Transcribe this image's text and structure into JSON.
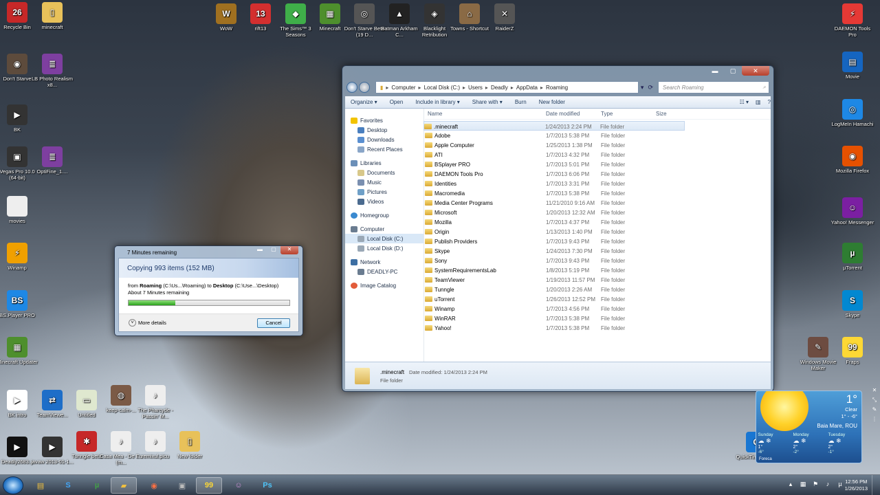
{
  "desktop_icons": [
    {
      "label": "Recycle Bin",
      "icon": "recycle-bin-icon",
      "color": "#c62828",
      "glyph": "26"
    },
    {
      "label": "minecraft",
      "icon": "folder-icon",
      "color": "#e8c15a",
      "glyph": "▯"
    },
    {
      "label": "Don't Starve",
      "icon": "game-icon",
      "color": "#5d4b3c",
      "glyph": "◉"
    },
    {
      "label": "LB Photo Realism x8...",
      "icon": "archive-icon",
      "color": "#7e3fa0",
      "glyph": "≣"
    },
    {
      "label": "BK",
      "icon": "video-icon",
      "color": "#333",
      "glyph": "▶"
    },
    {
      "label": "Vegas Pro 10.0 (64-bit)",
      "icon": "vegas-icon",
      "color": "#333",
      "glyph": "▣"
    },
    {
      "label": "OptiFine_1....",
      "icon": "archive-icon",
      "color": "#7e3fa0",
      "glyph": "≣"
    },
    {
      "label": "movies",
      "icon": "file-icon",
      "color": "#eeeeee",
      "glyph": ""
    },
    {
      "label": "Winamp",
      "icon": "winamp-icon",
      "color": "#f0a000",
      "glyph": "⚡"
    },
    {
      "label": "BS.Player PRO",
      "icon": "bsplayer-icon",
      "color": "#1e88e5",
      "glyph": "BS"
    },
    {
      "label": "Minecraft Updater",
      "icon": "minecraft-icon",
      "color": "#4e8f2d",
      "glyph": "▦"
    },
    {
      "label": "BK intro",
      "icon": "video-icon",
      "color": "#ffffff",
      "glyph": "▶"
    },
    {
      "label": "TeamViewe...",
      "icon": "teamviewer-icon",
      "color": "#1e6ec8",
      "glyph": "⇄"
    },
    {
      "label": "Untitled",
      "icon": "image-icon",
      "color": "#dfe8cf",
      "glyph": "▭"
    },
    {
      "label": "keep-calm-...",
      "icon": "image-icon",
      "color": "#7b5a46",
      "glyph": "◍"
    },
    {
      "label": "The Pharcyde - Passin' M...",
      "icon": "audio-icon",
      "color": "#eeeeee",
      "glyph": "♪"
    },
    {
      "label": "Deadly2683...",
      "icon": "video-icon",
      "color": "#111",
      "glyph": "▶"
    },
    {
      "label": "javaw 2013-01-1...",
      "icon": "video-icon",
      "color": "#333",
      "glyph": "▶"
    },
    {
      "label": "Tunngle beta",
      "icon": "tunngle-icon",
      "color": "#c62828",
      "glyph": "✱"
    },
    {
      "label": "Casa Mea - De Eu (m...",
      "icon": "audio-icon",
      "color": "#eeeeee",
      "glyph": "♪"
    },
    {
      "label": "remixul.picu",
      "icon": "audio-icon",
      "color": "#eeeeee",
      "glyph": "♪"
    },
    {
      "label": "New folder",
      "icon": "folder-icon",
      "color": "#e8c15a",
      "glyph": "▯"
    },
    {
      "label": "WoW",
      "icon": "wow-icon",
      "color": "#a07020",
      "glyph": "W"
    },
    {
      "label": "rift13",
      "icon": "rift-icon",
      "color": "#d32f2f",
      "glyph": "13"
    },
    {
      "label": "The Sims™ 3 Seasons",
      "icon": "sims-icon",
      "color": "#3fae49",
      "glyph": "◆"
    },
    {
      "label": "Minecraft",
      "icon": "minecraft-icon",
      "color": "#4e8f2d",
      "glyph": "▦"
    },
    {
      "label": "Don't Starve Beta (19 D...",
      "icon": "game-icon",
      "color": "#555",
      "glyph": "◎"
    },
    {
      "label": "Batman Arkham C...",
      "icon": "batman-icon",
      "color": "#222",
      "glyph": "▲"
    },
    {
      "label": "Blacklight Retribution",
      "icon": "blacklight-icon",
      "color": "#333",
      "glyph": "◈"
    },
    {
      "label": "Towns - Shortcut",
      "icon": "towns-icon",
      "color": "#8a6a45",
      "glyph": "⌂"
    },
    {
      "label": "RaiderZ",
      "icon": "raiderz-icon",
      "color": "#555",
      "glyph": "✕"
    },
    {
      "label": "DAEMON Tools Pro",
      "icon": "daemon-icon",
      "color": "#e53935",
      "glyph": "⚡"
    },
    {
      "label": "Movie",
      "icon": "movie-icon",
      "color": "#1565c0",
      "glyph": "▤"
    },
    {
      "label": "LogMeIn Hamachi",
      "icon": "hamachi-icon",
      "color": "#1e88e5",
      "glyph": "◎"
    },
    {
      "label": "Mozilla Firefox",
      "icon": "firefox-icon",
      "color": "#e65100",
      "glyph": "◉"
    },
    {
      "label": "Yahoo! Messenger",
      "icon": "yahoo-icon",
      "color": "#7b1fa2",
      "glyph": "☺"
    },
    {
      "label": "µTorrent",
      "icon": "utorrent-icon",
      "color": "#2e7d32",
      "glyph": "µ"
    },
    {
      "label": "Skype",
      "icon": "skype-icon",
      "color": "#0288d1",
      "glyph": "S"
    },
    {
      "label": "Windows Movie Maker",
      "icon": "moviemaker-icon",
      "color": "#6d4c41",
      "glyph": "✎"
    },
    {
      "label": "Fraps",
      "icon": "fraps-icon",
      "color": "#fdd835",
      "glyph": "99"
    },
    {
      "label": "QuickTime Player",
      "icon": "quicktime-icon",
      "color": "#1976d2",
      "glyph": "Q"
    }
  ],
  "explorer": {
    "breadcrumb": [
      "Computer",
      "Local Disk (C:)",
      "Users",
      "Deadly",
      "AppData",
      "Roaming"
    ],
    "search_placeholder": "Search Roaming",
    "toolbar": {
      "organize": "Organize ▾",
      "open": "Open",
      "include": "Include in library ▾",
      "share": "Share with ▾",
      "burn": "Burn",
      "new_folder": "New folder"
    },
    "columns": {
      "name": "Name",
      "date": "Date modified",
      "type": "Type",
      "size": "Size"
    },
    "nav": {
      "favorites": "Favorites",
      "desktop": "Desktop",
      "downloads": "Downloads",
      "recent": "Recent Places",
      "libraries": "Libraries",
      "documents": "Documents",
      "music": "Music",
      "pictures": "Pictures",
      "videos": "Videos",
      "homegroup": "Homegroup",
      "computer": "Computer",
      "local_c": "Local Disk (C:)",
      "local_d": "Local Disk (D:)",
      "network": "Network",
      "deadly_pc": "DEADLY-PC",
      "image_catalog": "Image Catalog"
    },
    "files": [
      {
        "name": ".minecraft",
        "date": "1/24/2013 2:24 PM",
        "type": "File folder"
      },
      {
        "name": "Adobe",
        "date": "1/7/2013 5:38 PM",
        "type": "File folder"
      },
      {
        "name": "Apple Computer",
        "date": "1/25/2013 1:38 PM",
        "type": "File folder"
      },
      {
        "name": "ATI",
        "date": "1/7/2013 4:32 PM",
        "type": "File folder"
      },
      {
        "name": "BSplayer PRO",
        "date": "1/7/2013 5:01 PM",
        "type": "File folder"
      },
      {
        "name": "DAEMON Tools Pro",
        "date": "1/7/2013 6:06 PM",
        "type": "File folder"
      },
      {
        "name": "Identities",
        "date": "1/7/2013 3:31 PM",
        "type": "File folder"
      },
      {
        "name": "Macromedia",
        "date": "1/7/2013 5:38 PM",
        "type": "File folder"
      },
      {
        "name": "Media Center Programs",
        "date": "11/21/2010 9:16 AM",
        "type": "File folder"
      },
      {
        "name": "Microsoft",
        "date": "1/20/2013 12:32 AM",
        "type": "File folder"
      },
      {
        "name": "Mozilla",
        "date": "1/7/2013 4:37 PM",
        "type": "File folder"
      },
      {
        "name": "Origin",
        "date": "1/13/2013 1:40 PM",
        "type": "File folder"
      },
      {
        "name": "Publish Providers",
        "date": "1/7/2013 9:43 PM",
        "type": "File folder"
      },
      {
        "name": "Skype",
        "date": "1/24/2013 7:30 PM",
        "type": "File folder"
      },
      {
        "name": "Sony",
        "date": "1/7/2013 9:43 PM",
        "type": "File folder"
      },
      {
        "name": "SystemRequirementsLab",
        "date": "1/8/2013 5:19 PM",
        "type": "File folder"
      },
      {
        "name": "TeamViewer",
        "date": "1/19/2013 11:57 PM",
        "type": "File folder"
      },
      {
        "name": "Tunngle",
        "date": "1/20/2013 2:26 AM",
        "type": "File folder"
      },
      {
        "name": "uTorrent",
        "date": "1/26/2013 12:52 PM",
        "type": "File folder"
      },
      {
        "name": "Winamp",
        "date": "1/7/2013 4:56 PM",
        "type": "File folder"
      },
      {
        "name": "WinRAR",
        "date": "1/7/2013 5:38 PM",
        "type": "File folder"
      },
      {
        "name": "Yahoo!",
        "date": "1/7/2013 5:38 PM",
        "type": "File folder"
      }
    ],
    "details": {
      "name": ".minecraft",
      "modified": "Date modified: 1/24/2013 2:24 PM",
      "type": "File folder"
    }
  },
  "copy_dialog": {
    "title": "7 Minutes remaining",
    "header": "Copying 993 items (152 MB)",
    "from_label": "from",
    "from_name": "Roaming",
    "from_path": "(C:\\Us...\\Roaming)",
    "to_label": "to",
    "to_name": "Desktop",
    "to_path": "(C:\\Use...\\Desktop)",
    "remaining": "About 7 Minutes remaining",
    "progress": 0.29,
    "more_details": "More details",
    "cancel": "Cancel"
  },
  "weather": {
    "temp": "1°",
    "condition": "Clear",
    "range": "1° - -6°",
    "location": "Baia Mare, ROU",
    "days": [
      {
        "name": "Sunday",
        "hi": "1°",
        "lo": "-6°"
      },
      {
        "name": "Monday",
        "hi": "2°",
        "lo": "-2°"
      },
      {
        "name": "Tuesday",
        "hi": "2°",
        "lo": "-1°"
      }
    ],
    "source": "Foreca"
  },
  "taskbar": {
    "clock_time": "12:56 PM",
    "clock_date": "1/26/2013"
  },
  "colors": {
    "accent": "#3b6ea5",
    "progress": "#2aa21b",
    "selection": "#dde9f6"
  }
}
